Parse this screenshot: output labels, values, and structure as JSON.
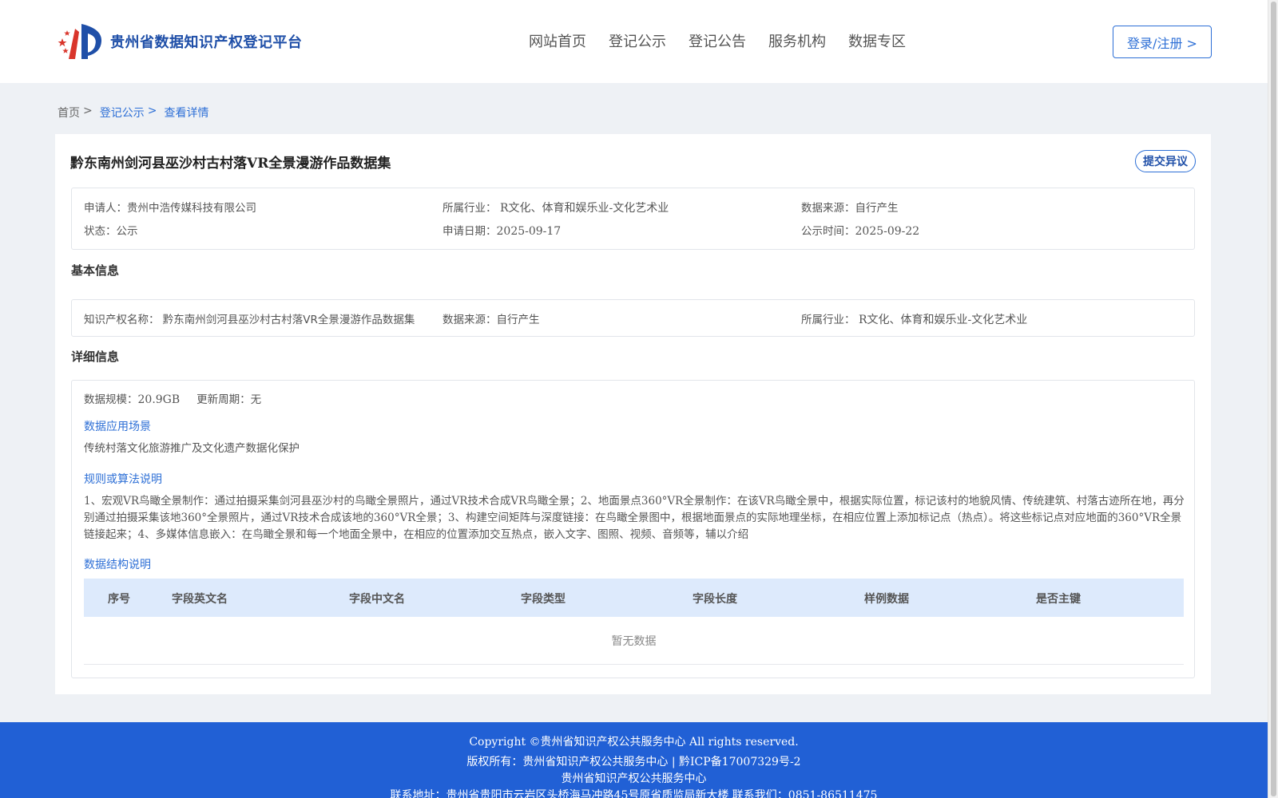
{
  "header": {
    "logo_text": "贵州省数据知识产权登记平台",
    "nav": [
      "网站首页",
      "登记公示",
      "登记公告",
      "服务机构",
      "数据专区"
    ],
    "login_label": "登录/注册 >"
  },
  "breadcrumb": {
    "home": "首页",
    "sep": ">",
    "level1": "登记公示",
    "current": "查看详情"
  },
  "card": {
    "title": "黔东南州剑河县巫沙村古村落VR全景漫游作品数据集",
    "objection_label": "提交异议",
    "summary": {
      "applicant_label": "申请人：",
      "applicant": "贵州中浩传媒科技有限公司",
      "industry_label": "所属行业：",
      "industry": " R文化、体育和娱乐业-文化艺术业",
      "source_label": "数据来源：",
      "source": "自行产生",
      "status_label": "状态：",
      "status": "公示",
      "apply_date_label": "申请日期：",
      "apply_date": "2025-09-17",
      "publish_date_label": "公示时间：",
      "publish_date": "2025-09-22"
    },
    "basic": {
      "heading": "基本信息",
      "ip_name_label": "知识产权名称：",
      "ip_name": " 黔东南州剑河县巫沙村古村落VR全景漫游作品数据集",
      "source_label": "数据来源：",
      "source": "自行产生",
      "industry_label": "所属行业：",
      "industry": " R文化、体育和娱乐业-文化艺术业"
    },
    "detail": {
      "heading": "详细信息",
      "scale_label": "数据规模：",
      "scale": "20.9GB",
      "cycle_label": "更新周期：",
      "cycle": "无",
      "scenario_heading": "数据应用场景",
      "scenario": "传统村落文化旅游推广及文化遗产数据化保护",
      "algorithm_heading": "规则或算法说明",
      "algorithm": "1、宏观VR鸟瞰全景制作：通过拍摄采集剑河县巫沙村的鸟瞰全景照片，通过VR技术合成VR鸟瞰全景；2、地面景点360°VR全景制作：在该VR鸟瞰全景中，根据实际位置，标记该村的地貌风情、传统建筑、村落古迹所在地，再分别通过拍摄采集该地360°全景照片，通过VR技术合成该地的360°VR全景；3、构建空间矩阵与深度链接：在鸟瞰全景图中，根据地面景点的实际地理坐标，在相应位置上添加标记点（热点）。将这些标记点对应地面的360°VR全景链接起来；4、多媒体信息嵌入：在鸟瞰全景和每一个地面全景中，在相应的位置添加交互热点，嵌入文字、图照、视频、音频等，辅以介绍",
      "structure_heading": "数据结构说明",
      "columns": [
        "序号",
        "字段英文名",
        "字段中文名",
        "字段类型",
        "字段长度",
        "样例数据",
        "是否主键"
      ],
      "empty_text": "暂无数据"
    }
  },
  "footer": {
    "line1": "Copyright ©贵州省知识产权公共服务中心 All rights reserved.",
    "line2": "版权所有：贵州省知识产权公共服务中心 | 黔ICP备17007329号-2",
    "line3": "贵州省知识产权公共服务中心",
    "line4": "联系地址：贵州省贵阳市云岩区头桥海马冲路45号原省质监局新大楼 联系我们：0851-86511475"
  }
}
